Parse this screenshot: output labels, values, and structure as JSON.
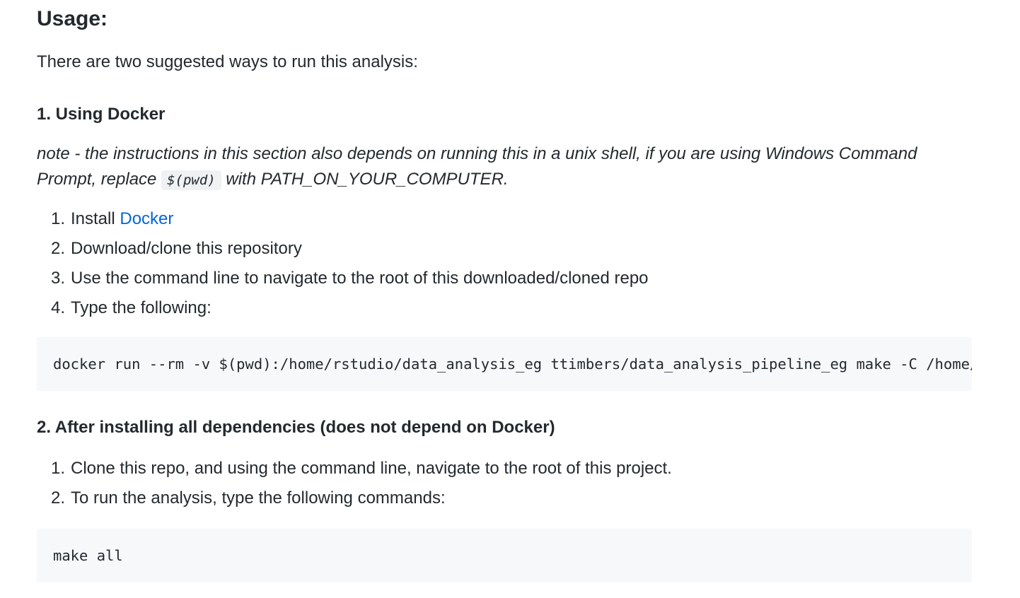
{
  "usage": {
    "heading": "Usage:",
    "intro": "There are two suggested ways to run this analysis:"
  },
  "docker_section": {
    "heading": "1. Using Docker",
    "note_before": "note - the instructions in this section also depends on running this in a unix shell, if you are using Windows Command Prompt, replace ",
    "note_code": "$(pwd)",
    "note_after": " with PATH_ON_YOUR_COMPUTER.",
    "steps": [
      {
        "num": "1.",
        "text": "Install ",
        "link": "Docker"
      },
      {
        "num": "2.",
        "text": "Download/clone this repository"
      },
      {
        "num": "3.",
        "text": "Use the command line to navigate to the root of this downloaded/cloned repo"
      },
      {
        "num": "4.",
        "text": "Type the following:"
      }
    ],
    "command": "docker run --rm -v $(pwd):/home/rstudio/data_analysis_eg ttimbers/data_analysis_pipeline_eg make -C /home/"
  },
  "deps_section": {
    "heading": "2. After installing all dependencies (does not depend on Docker)",
    "steps": [
      {
        "num": "1.",
        "text": "Clone this repo, and using the command line, navigate to the root of this project."
      },
      {
        "num": "2.",
        "text": "To run the analysis, type the following commands:"
      }
    ],
    "command": "make all"
  },
  "colors": {
    "text": "#24292e",
    "link": "#0366d6",
    "code_background": "#f6f8fa"
  }
}
